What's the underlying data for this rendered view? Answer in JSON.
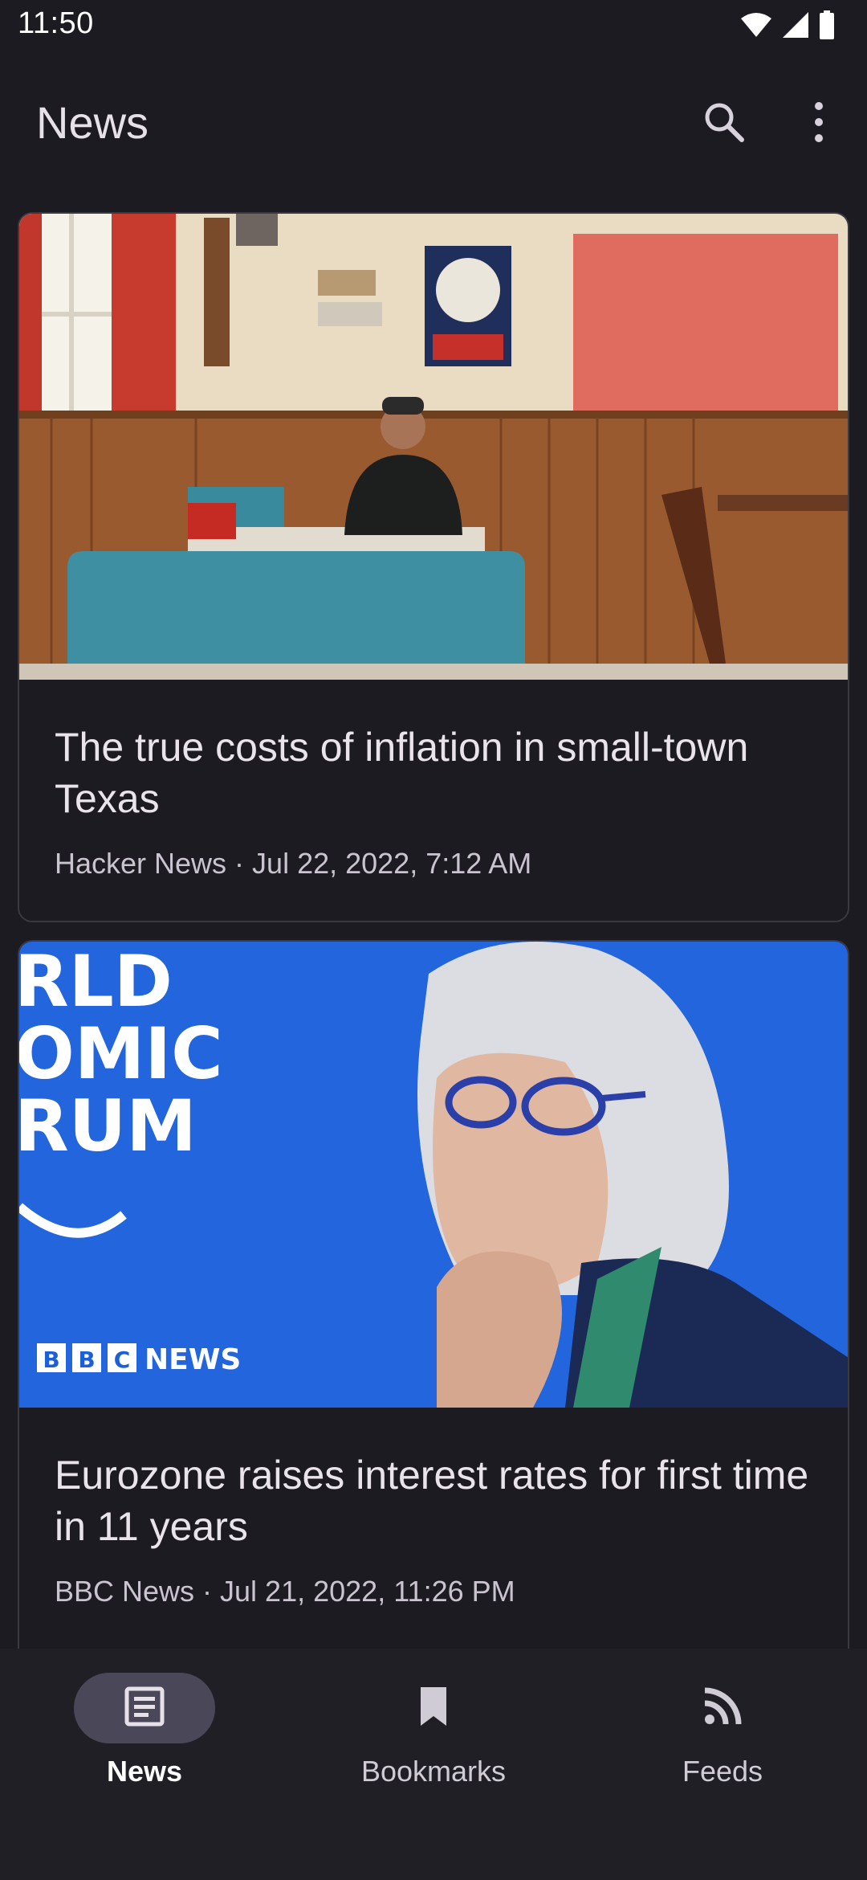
{
  "status_bar": {
    "time": "11:50",
    "icons": [
      "wifi-icon",
      "cellular-signal-icon",
      "battery-icon"
    ]
  },
  "app_bar": {
    "title": "News",
    "actions": [
      "search-icon",
      "more-vert-icon"
    ]
  },
  "articles": [
    {
      "title": "The true costs of inflation in small-town Texas",
      "meta": "Hacker News · Jul 22, 2022, 7:12 AM",
      "image": "photo of a man seated in a wood-paneled diner booth"
    },
    {
      "title": "Eurozone raises interest rates for first time in 11 years",
      "meta": "BBC News · Jul 21, 2022, 11:26 PM",
      "image": "photo of a white-haired woman with glasses in front of a blue World Economic Forum backdrop",
      "image_text": {
        "backdrop_lines": [
          "RLD",
          "OMIC",
          "RUM"
        ],
        "logo_letters": [
          "B",
          "B",
          "C"
        ],
        "logo_word": "NEWS"
      }
    }
  ],
  "bottom_nav": {
    "items": [
      {
        "label": "News",
        "icon": "article-icon",
        "active": true
      },
      {
        "label": "Bookmarks",
        "icon": "bookmark-icon",
        "active": false
      },
      {
        "label": "Feeds",
        "icon": "rss-feed-icon",
        "active": false
      }
    ]
  },
  "colors": {
    "background": "#1c1b21",
    "nav_background": "#211f26",
    "active_pill": "#4a4758",
    "card_border": "#3a3840",
    "bbc_blue": "#1d5fd6"
  }
}
